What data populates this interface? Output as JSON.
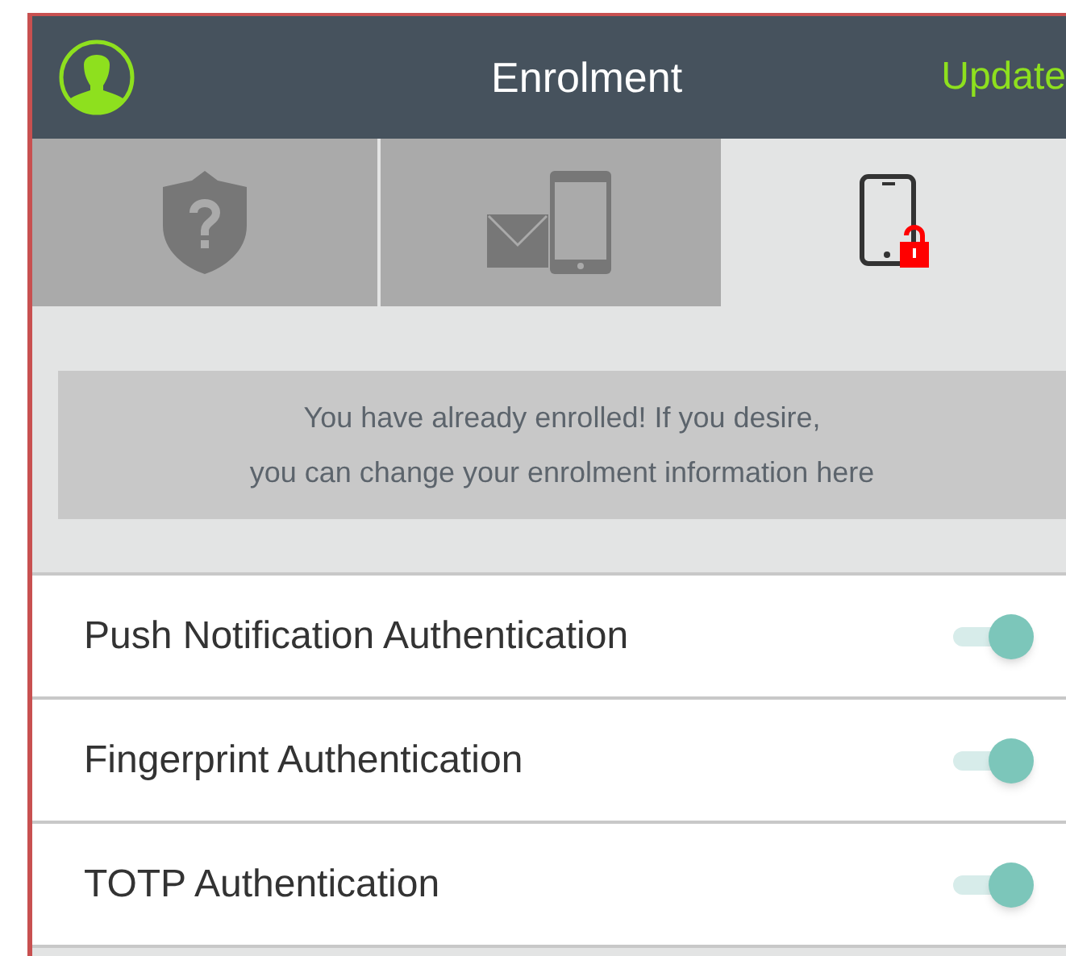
{
  "header": {
    "title": "Enrolment",
    "action": "Update"
  },
  "tabs": [
    {
      "kind": "question",
      "selected": false
    },
    {
      "kind": "message",
      "selected": false
    },
    {
      "kind": "device",
      "selected": true
    }
  ],
  "notice": {
    "line1": "You have already enrolled! If you desire,",
    "line2": "you can change your enrolment information here"
  },
  "options": [
    {
      "label": "Push Notification Authentication",
      "on": true
    },
    {
      "label": "Fingerprint Authentication",
      "on": true
    },
    {
      "label": "TOTP Authentication",
      "on": true
    }
  ]
}
